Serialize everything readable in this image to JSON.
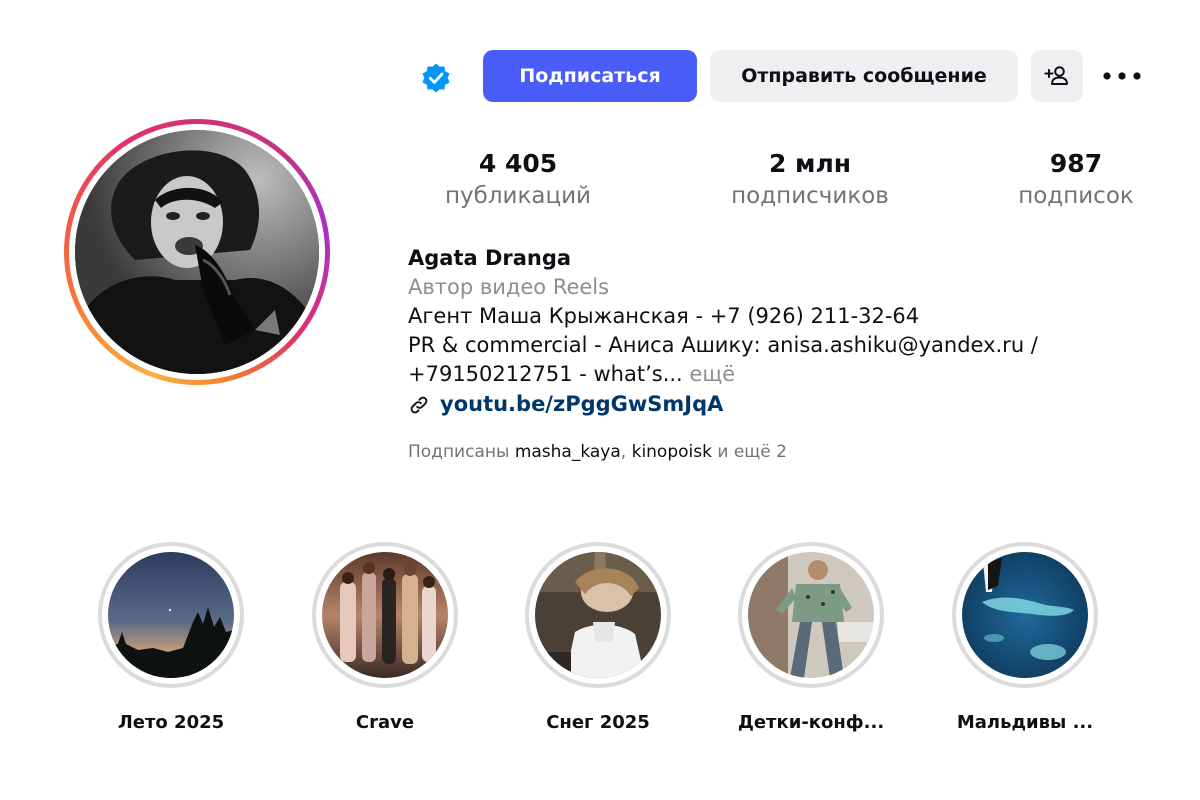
{
  "header": {
    "verified_icon": "verified-badge-icon",
    "follow_label": "Подписаться",
    "message_label": "Отправить сообщение",
    "add_user_icon": "add-person-icon",
    "more_icon": "more-dots-icon",
    "follow_color": "#4a5df9"
  },
  "stats": {
    "posts": {
      "value": "4 405",
      "label": "публикаций"
    },
    "followers": {
      "value": "2 млн",
      "label": "подписчиков"
    },
    "following": {
      "value": "987",
      "label": "подписок"
    }
  },
  "bio": {
    "name": "Agata Dranga",
    "category": "Автор видео Reels",
    "line1": "Агент Маша Крыжанская - +7 (926) 211-32-64",
    "line2": "PR & commercial - Аниса Ашику: anisa.ashiku@yandex.ru /",
    "line3": "+79150212751 - what’s...",
    "more": "ещё",
    "link_icon": "link-icon",
    "link": "youtu.be/zPggGwSmJqA"
  },
  "followed_by": {
    "prefix": "Подписаны",
    "account1": "masha_kaya",
    "separator": ",",
    "account2": "kinopoisk",
    "suffix": "и ещё 2"
  },
  "highlights": [
    {
      "title": "Лето 2025"
    },
    {
      "title": "Crave"
    },
    {
      "title": "Снег 2025"
    },
    {
      "title": "Детки-конф..."
    },
    {
      "title": "Мальдивы ..."
    }
  ]
}
